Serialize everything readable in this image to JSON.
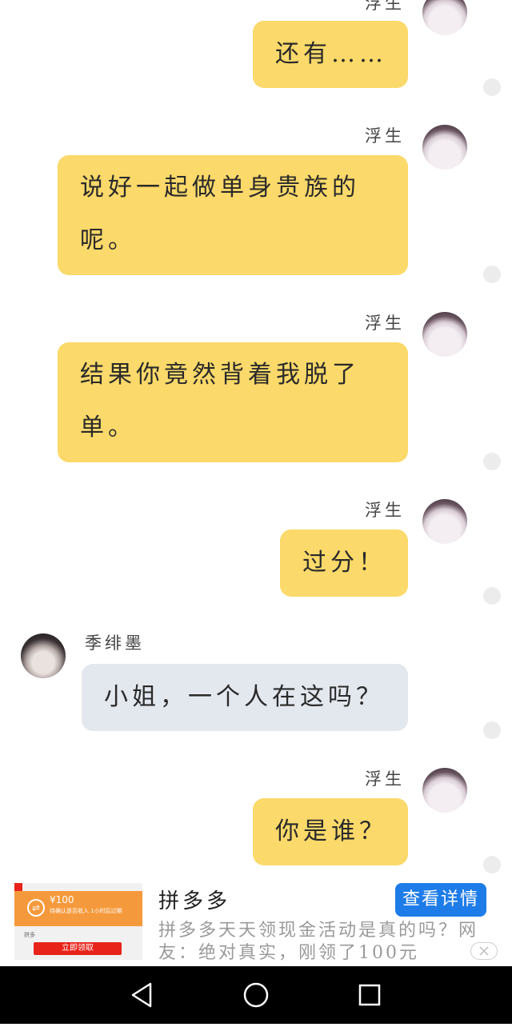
{
  "chat": {
    "messages": [
      {
        "sender": "浮生",
        "side": "right",
        "text": "还有……"
      },
      {
        "sender": "浮生",
        "side": "right",
        "text_lines": [
          "说好一起做单身贵族的",
          "呢。"
        ]
      },
      {
        "sender": "浮生",
        "side": "right",
        "text_lines": [
          "结果你竟然背着我脱了",
          "单。"
        ]
      },
      {
        "sender": "浮生",
        "side": "right",
        "text": "过分！"
      },
      {
        "sender": "季绯墨",
        "side": "left",
        "text": "小姐，一个人在这吗？"
      },
      {
        "sender": "浮生",
        "side": "right",
        "text": "你是谁？"
      }
    ]
  },
  "ad": {
    "thumbnail": {
      "amount": "¥100",
      "subtitle": "待确认是否收入 1小时后过期",
      "label": "拼多",
      "button": "立即领取",
      "accent_color": "#f59a3c",
      "button_color": "#e8231a"
    },
    "title": "拼多多",
    "cta": "查看详情",
    "description": "拼多多天天领现金活动是真的吗？网友：绝对真实，刚领了100元"
  },
  "navbar": {
    "back_icon": "triangle-back-icon",
    "home_icon": "circle-home-icon",
    "recents_icon": "square-recents-icon"
  },
  "colors": {
    "my_bubble": "#fbd96a",
    "their_bubble": "#e3e7ee",
    "cta_blue": "#1e7ce8",
    "navbar": "#000000"
  }
}
